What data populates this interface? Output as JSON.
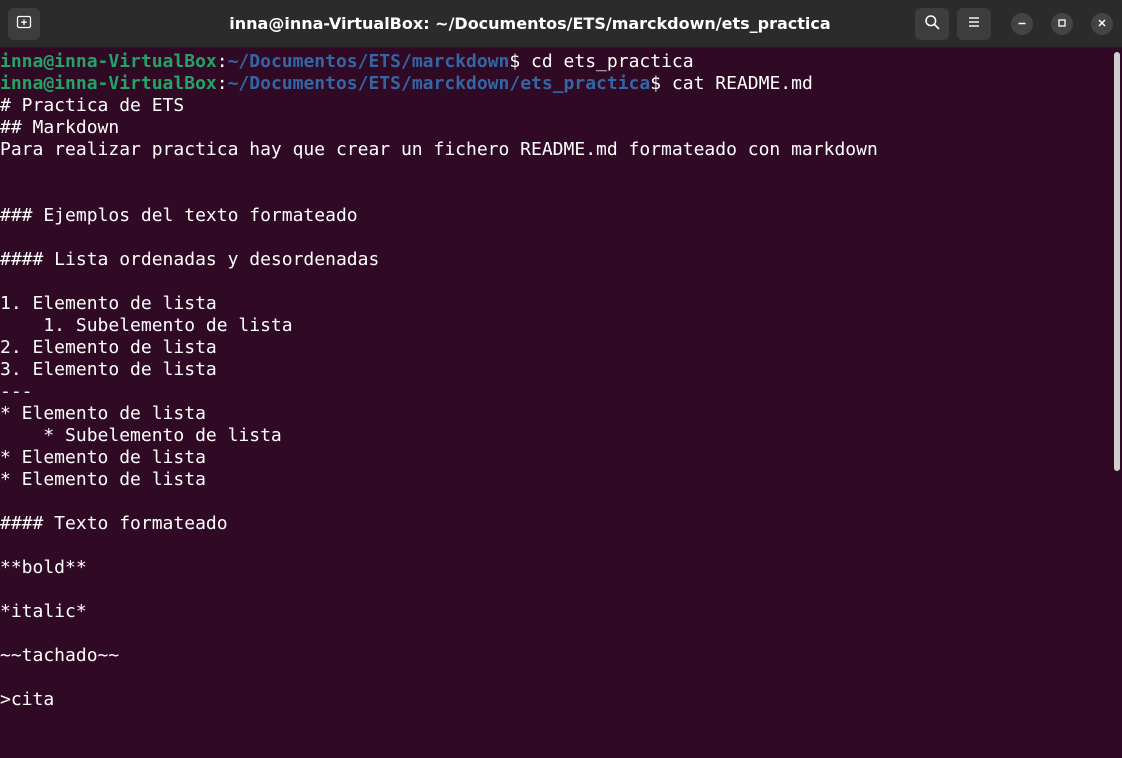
{
  "window": {
    "title": "inna@inna-VirtualBox: ~/Documentos/ETS/marckdown/ets_practica"
  },
  "icons": {
    "new_tab": "new-tab-icon",
    "search": "search-icon",
    "menu": "hamburger-menu-icon",
    "minimize": "minimize-icon",
    "maximize": "maximize-icon",
    "close": "close-icon"
  },
  "colors": {
    "terminal_bg": "#300a24",
    "prompt_user": "#26a269",
    "prompt_path": "#3465a4",
    "titlebar_bg": "#2b2b2b"
  },
  "terminal": {
    "prompts": [
      {
        "user_host": "inna@inna-VirtualBox",
        "colon": ":",
        "path": "~/Documentos/ETS/marckdown",
        "symbol": "$",
        "command": " cd ets_practica"
      },
      {
        "user_host": "inna@inna-VirtualBox",
        "colon": ":",
        "path": "~/Documentos/ETS/marckdown/ets_practica",
        "symbol": "$",
        "command": " cat README.md"
      }
    ],
    "output": [
      "# Practica de ETS",
      "## Markdown",
      "Para realizar practica hay que crear un fichero README.md formateado con markdown",
      "",
      "",
      "### Ejemplos del texto formateado",
      "",
      "#### Lista ordenadas y desordenadas",
      "",
      "1. Elemento de lista",
      "    1. Subelemento de lista",
      "2. Elemento de lista",
      "3. Elemento de lista",
      "---",
      "* Elemento de lista",
      "    * Subelemento de lista",
      "* Elemento de lista",
      "* Elemento de lista",
      "",
      "#### Texto formateado",
      "",
      "**bold**",
      "",
      "*italic*",
      "",
      "~~tachado~~",
      "",
      ">cita"
    ]
  }
}
